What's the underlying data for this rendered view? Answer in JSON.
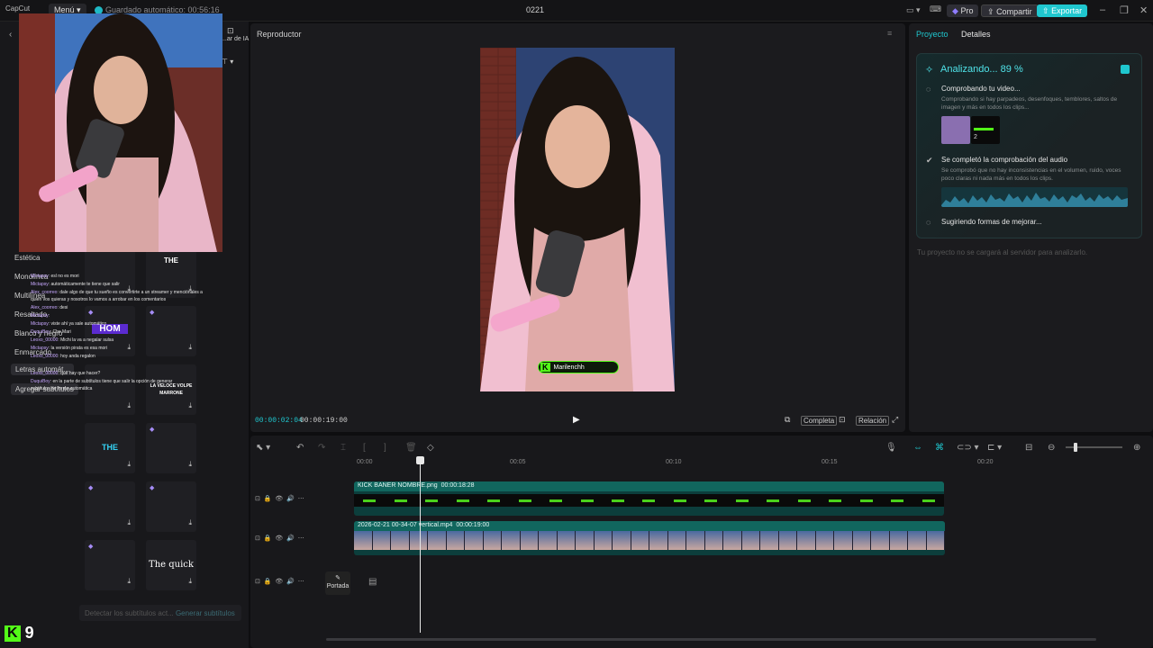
{
  "topbar": {
    "logo": "CapCut",
    "menu_label": "Menú",
    "autosave": "Guardado automático: 00:56:16",
    "title": "0221",
    "pro_label": "Pro",
    "share_label": "Compartir",
    "export_label": "Exportar"
  },
  "left_panel": {
    "tool_label": "...ar de IA",
    "categories": [
      "Estética",
      "Monolínea",
      "Multilínea",
      "Resaltado",
      "Blanco y negro",
      "Enmarcado"
    ],
    "chips": [
      "Letras automát...",
      "Agregar subtítulos"
    ],
    "bottom_hint": "Detectar los subtítulos act...",
    "bottom_hint_link": "Generar subtítulos",
    "kick_count": "9",
    "tile_texts": [
      "THE",
      "HOM",
      "LA VELOCE VOLPE MARRONE",
      "THE",
      "The quick"
    ],
    "chat_lines": [
      {
        "user": "Mictapsy",
        "msg": ": esl no es mori"
      },
      {
        "user": "Mictapsy",
        "msg": ": automáticamente te tiene que salir"
      },
      {
        "user": "Alex_coorreo",
        "msg": ": dale algo de que tu sueño es convertirte a un streamer y menciónales a"
      },
      {
        "user": "",
        "msg": "quien vos quieras y nosotros lo vamos a arrobar en los comentarios"
      },
      {
        "user": "Alex_coorreo",
        "msg": ": desi"
      },
      {
        "user": "Mictapsy",
        "msg": ":"
      },
      {
        "user": "Mictapsy",
        "msg": ": viste ahí ya sale automático"
      },
      {
        "user": "DuquiBoy",
        "msg": ": Che Mari"
      },
      {
        "user": "Leoxo_00000",
        "msg": ": Michi la va a negalar sulsa"
      },
      {
        "user": "Mictapsy",
        "msg": ": la versión pirata es esa mori"
      },
      {
        "user": "Leoxo_00000",
        "msg": ": hoy anda regalon"
      },
      {
        "user": "Leoxo_00000",
        "msg": ": qué hay que hacer?"
      },
      {
        "user": "DuquiBoy",
        "msg": ": en la parte de subtítulos tiene que salir la opción de generar"
      },
      {
        "user": "",
        "msg": "subtítulos de forma automática"
      }
    ]
  },
  "player": {
    "title": "Reproductor",
    "overlay_name": "Marilenchh",
    "time_current": "00:00:02:04",
    "time_total": "00:00:19:00",
    "fit_label": "Completa",
    "ratio_label": "Relación"
  },
  "right_panel": {
    "tabs": [
      "Proyecto",
      "Detalles"
    ],
    "active_tab": "Proyecto",
    "analysis_title": "Analizando... 89 %",
    "analysis_progress": 0.89,
    "steps": [
      {
        "title": "Comprobando tu video...",
        "desc": "Comprobando si hay parpadeos, desenfoques, temblores, saltos de imagen y más en todos los clips...",
        "status": "loading"
      },
      {
        "title": "Se completó la comprobación del audio",
        "desc": "Se comprobó que no hay inconsistencias en el volumen, ruido, voces poco claras ni nada más en todos los clips.",
        "status": "done"
      },
      {
        "title": "Sugiriendo formas de mejorar...",
        "desc": "",
        "status": "loading"
      }
    ],
    "thumb_count": "2",
    "note": "Tu proyecto no se cargará al servidor para analizarlo."
  },
  "timeline": {
    "ruler": [
      "00:00",
      "00:05",
      "00:10",
      "00:15",
      "00:20"
    ],
    "clip_a": {
      "name": "KICK BANER NOMBRE.png",
      "duration": "00:00:18:28"
    },
    "clip_b": {
      "name": "2026-02-21 00-34-07 vertical.mp4",
      "duration": "00:00:19:00"
    },
    "cover_label": "Portada"
  },
  "colors": {
    "accent": "#1fc7cf",
    "kick_green": "#53fc18",
    "clip_bg": "#0c3e3c"
  }
}
